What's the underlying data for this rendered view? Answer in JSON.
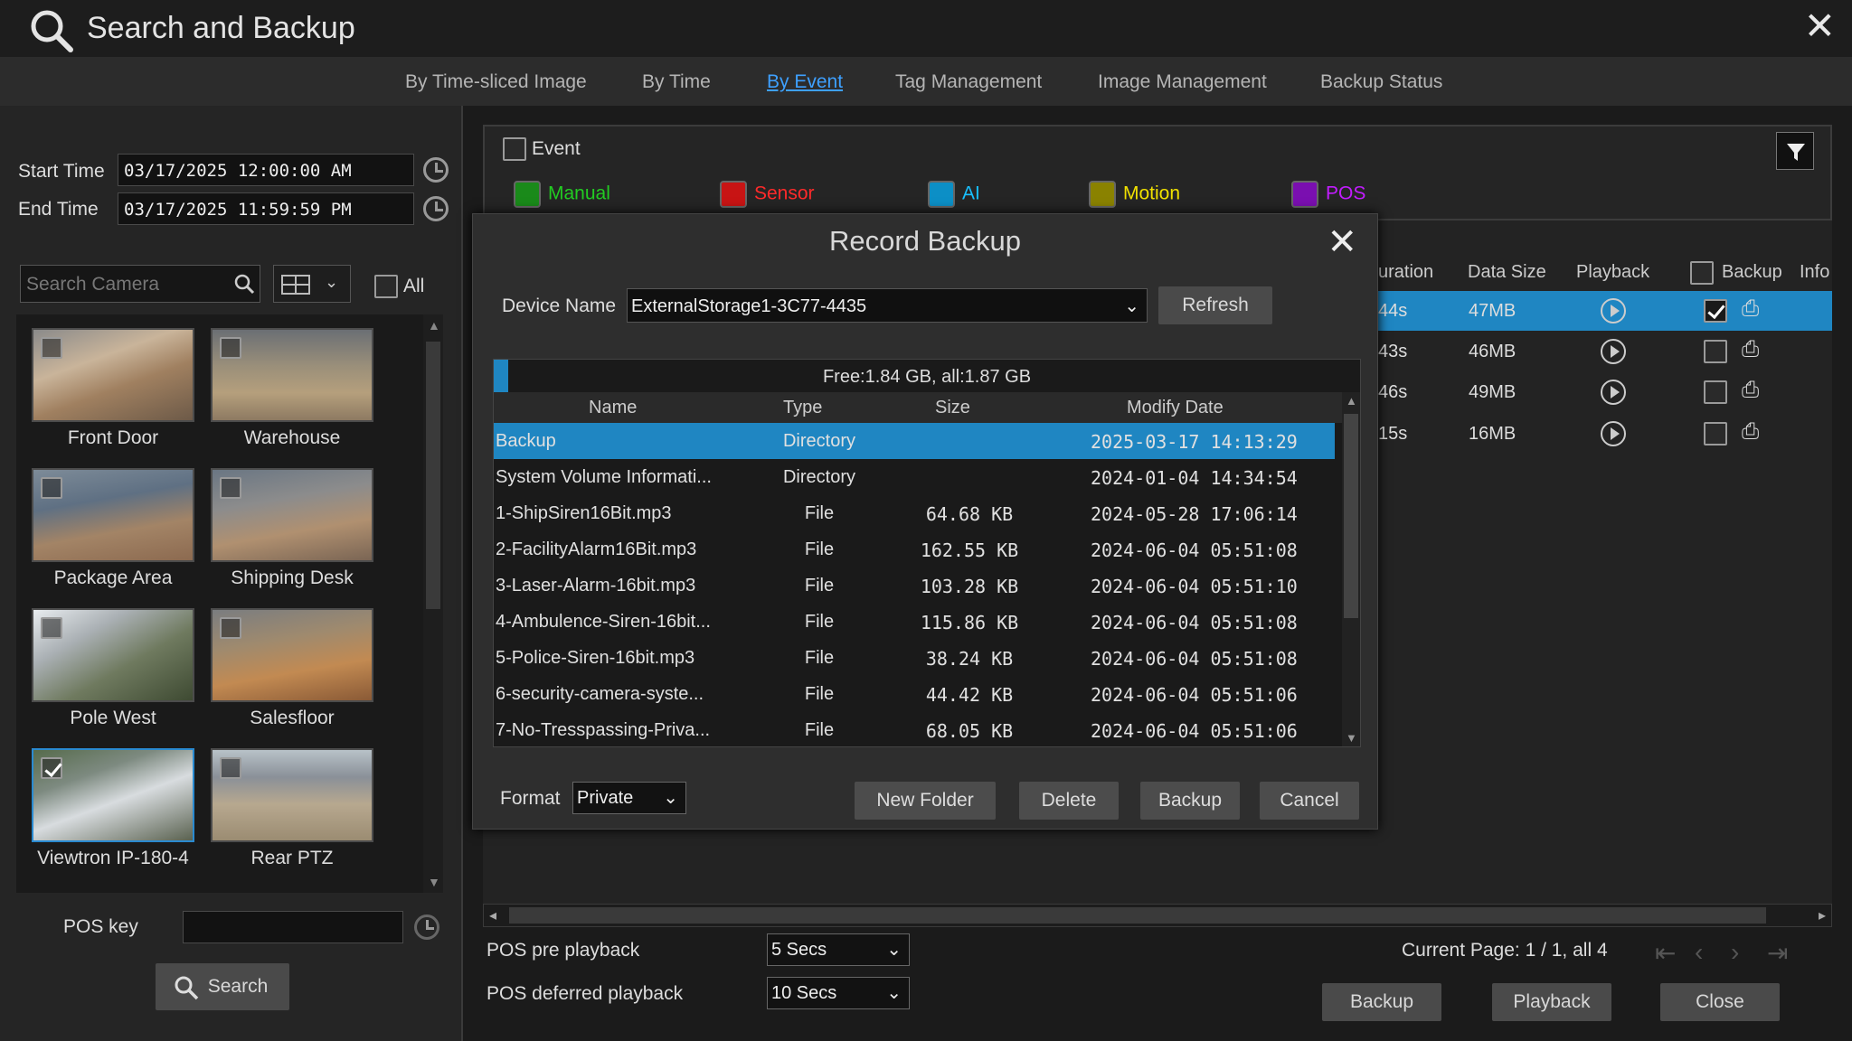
{
  "window": {
    "title": "Search and Backup"
  },
  "tabs": [
    "By Time-sliced Image",
    "By Time",
    "By Event",
    "Tag Management",
    "Image Management",
    "Backup Status"
  ],
  "active_tab": "By Event",
  "left": {
    "start_label": "Start Time",
    "start_value": "03/17/2025 12:00:00 AM",
    "end_label": "End Time",
    "end_value": "03/17/2025 11:59:59 PM",
    "search_placeholder": "Search Camera",
    "all_label": "All",
    "cameras": [
      "Front Door",
      "Warehouse",
      "Package Area",
      "Shipping Desk",
      "Pole West",
      "Salesfloor",
      "Viewtron IP-180-4",
      "Rear PTZ"
    ],
    "pos_key_label": "POS key",
    "search_button": "Search"
  },
  "events": {
    "event_label": "Event",
    "types": [
      "Manual",
      "Sensor",
      "AI",
      "Motion",
      "POS"
    ],
    "colors": {
      "Manual": "#22cc22",
      "Sensor": "#ff2a2a",
      "AI": "#18c0ff",
      "Motion": "#f0e000",
      "POS": "#c21cff"
    }
  },
  "results": {
    "headers": [
      "uration",
      "Data Size",
      "Playback",
      "Backup",
      "Info"
    ],
    "rows": [
      {
        "duration": "44s",
        "size": "47MB",
        "checked": true
      },
      {
        "duration": "43s",
        "size": "46MB",
        "checked": false
      },
      {
        "duration": "46s",
        "size": "49MB",
        "checked": false
      },
      {
        "duration": "15s",
        "size": "16MB",
        "checked": false
      }
    ]
  },
  "dialog": {
    "title": "Record Backup",
    "device_label": "Device Name",
    "device_value": "ExternalStorage1-3C77-4435",
    "refresh": "Refresh",
    "space": "Free:1.84 GB, all:1.87 GB",
    "headers": [
      "Name",
      "Type",
      "Size",
      "Modify Date"
    ],
    "files": [
      {
        "name": "Backup",
        "type": "Directory",
        "size": "",
        "date": "2025-03-17 14:13:29"
      },
      {
        "name": "System Volume Informati...",
        "type": "Directory",
        "size": "",
        "date": "2024-01-04 14:34:54"
      },
      {
        "name": "1-ShipSiren16Bit.mp3",
        "type": "File",
        "size": "64.68 KB",
        "date": "2024-05-28 17:06:14"
      },
      {
        "name": "2-FacilityAlarm16Bit.mp3",
        "type": "File",
        "size": "162.55 KB",
        "date": "2024-06-04 05:51:08"
      },
      {
        "name": "3-Laser-Alarm-16bit.mp3",
        "type": "File",
        "size": "103.28 KB",
        "date": "2024-06-04 05:51:10"
      },
      {
        "name": "4-Ambulence-Siren-16bit...",
        "type": "File",
        "size": "115.86 KB",
        "date": "2024-06-04 05:51:08"
      },
      {
        "name": "5-Police-Siren-16bit.mp3",
        "type": "File",
        "size": "38.24 KB",
        "date": "2024-06-04 05:51:08"
      },
      {
        "name": "6-security-camera-syste...",
        "type": "File",
        "size": "44.42 KB",
        "date": "2024-06-04 05:51:06"
      },
      {
        "name": "7-No-Tresspassing-Priva...",
        "type": "File",
        "size": "68.05 KB",
        "date": "2024-06-04 05:51:06"
      }
    ],
    "format_label": "Format",
    "format_value": "Private",
    "buttons": [
      "New Folder",
      "Delete",
      "Backup",
      "Cancel"
    ]
  },
  "bottom": {
    "pos_pre_label": "POS pre playback",
    "pos_pre_value": "5 Secs",
    "pos_def_label": "POS deferred playback",
    "pos_def_value": "10 Secs",
    "page_info": "Current Page: 1 / 1, all 4",
    "buttons": [
      "Backup",
      "Playback",
      "Close"
    ]
  }
}
